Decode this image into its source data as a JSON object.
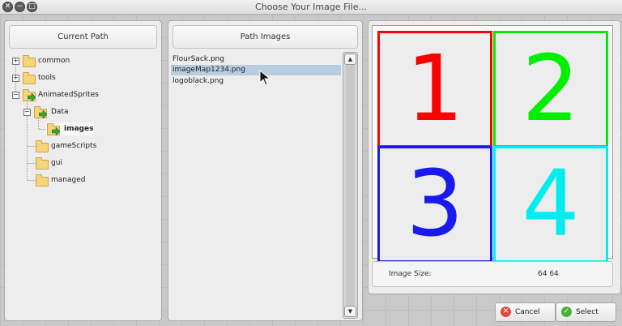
{
  "window": {
    "title": "Choose Your Image File..."
  },
  "left_panel": {
    "header": "Current Path",
    "tree": [
      {
        "label": "common",
        "expander": "+"
      },
      {
        "label": "tools",
        "expander": "+"
      },
      {
        "label": "AnimatedSprites",
        "expander": "−"
      },
      {
        "label": "Data",
        "expander": "−"
      },
      {
        "label": "images",
        "expander": ""
      },
      {
        "label": "gameScripts",
        "expander": ""
      },
      {
        "label": "gui",
        "expander": ""
      },
      {
        "label": "managed",
        "expander": ""
      }
    ]
  },
  "middle_panel": {
    "header": "Path Images",
    "files": [
      "FlourSack.png",
      "imageMap1234.png",
      "logoblack.png"
    ],
    "selected_index": 1
  },
  "right_panel": {
    "preview_cells": [
      {
        "label": "1",
        "color": "#ff0000"
      },
      {
        "label": "2",
        "color": "#00ee00"
      },
      {
        "label": "3",
        "color": "#1a1aee"
      },
      {
        "label": "4",
        "color": "#00eeee"
      }
    ],
    "image_size_label": "Image Size:",
    "image_size_value": "64 64"
  },
  "buttons": {
    "cancel": "Cancel",
    "select": "Select"
  },
  "colors": {
    "selection": "#b9cde0",
    "cancel_icon": "#e14b3b",
    "select_icon": "#4caf3c"
  }
}
